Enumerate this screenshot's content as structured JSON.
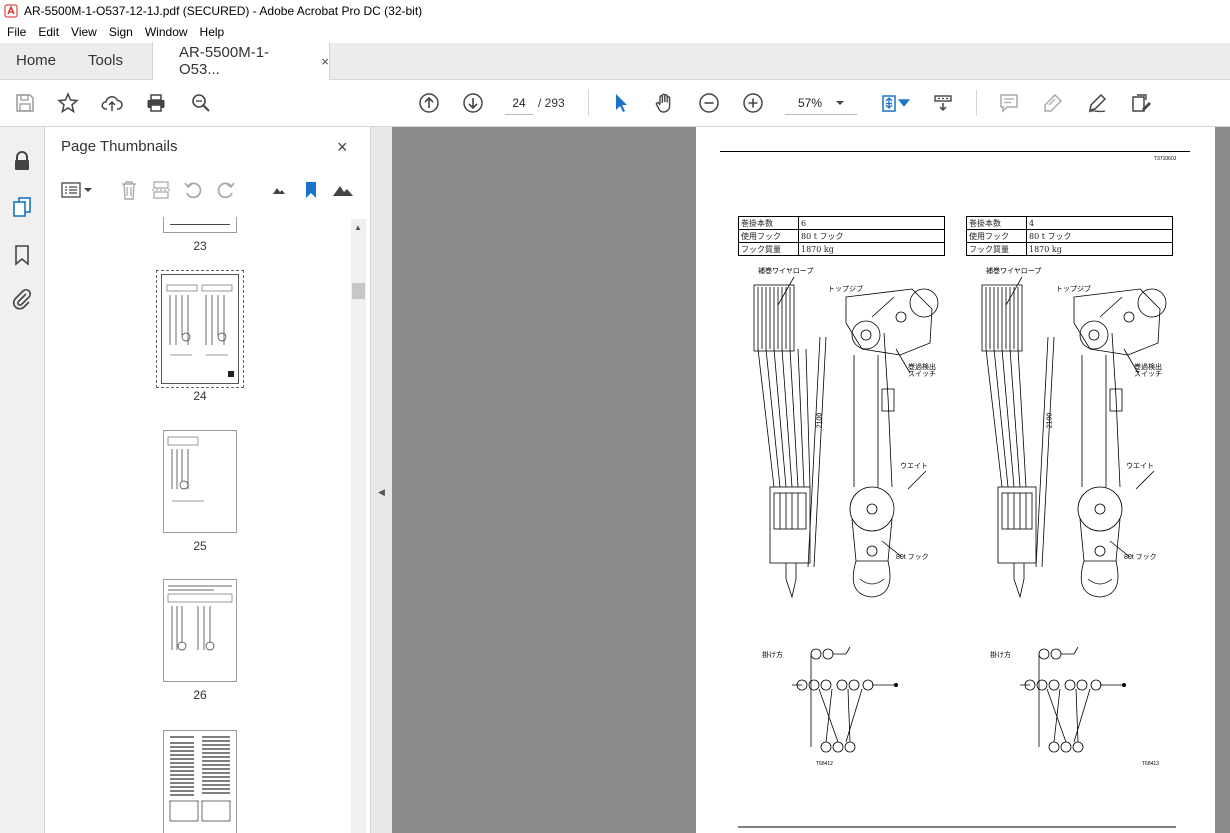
{
  "window": {
    "title": "AR-5500M-1-O537-12-1J.pdf (SECURED) - Adobe Acrobat Pro DC (32-bit)"
  },
  "menu": [
    "File",
    "Edit",
    "View",
    "Sign",
    "Window",
    "Help"
  ],
  "tabs": {
    "home": "Home",
    "tools": "Tools",
    "document": "AR-5500M-1-O53...",
    "close_glyph": "×"
  },
  "toolbar": {
    "current_page": "24",
    "total_pages": "/ 293",
    "zoom": "57%"
  },
  "panel": {
    "title": "Page Thumbnails",
    "close_glyph": "×",
    "thumbnails": [
      "23",
      "24",
      "25",
      "26"
    ]
  },
  "document": {
    "code_top": "T371060J",
    "tables": [
      {
        "rows": [
          [
            "巻掛本数",
            "6"
          ],
          [
            "使用フック",
            "80 t フック"
          ],
          [
            "フック質量",
            "1870 kg"
          ]
        ]
      },
      {
        "rows": [
          [
            "巻掛本数",
            "4"
          ],
          [
            "使用フック",
            "80 t フック"
          ],
          [
            "フック質量",
            "1870 kg"
          ]
        ]
      }
    ],
    "labels": {
      "wire_rope": "補巻ワイヤロープ",
      "top_jib": "トップジブ",
      "switch_1": "巻過検出",
      "switch_2": "スイッチ",
      "weight": "ウエイト",
      "hook": "80t フック",
      "dim": "2100",
      "reeving": "掛け方"
    },
    "codes": [
      "T68412",
      "T68413"
    ]
  }
}
